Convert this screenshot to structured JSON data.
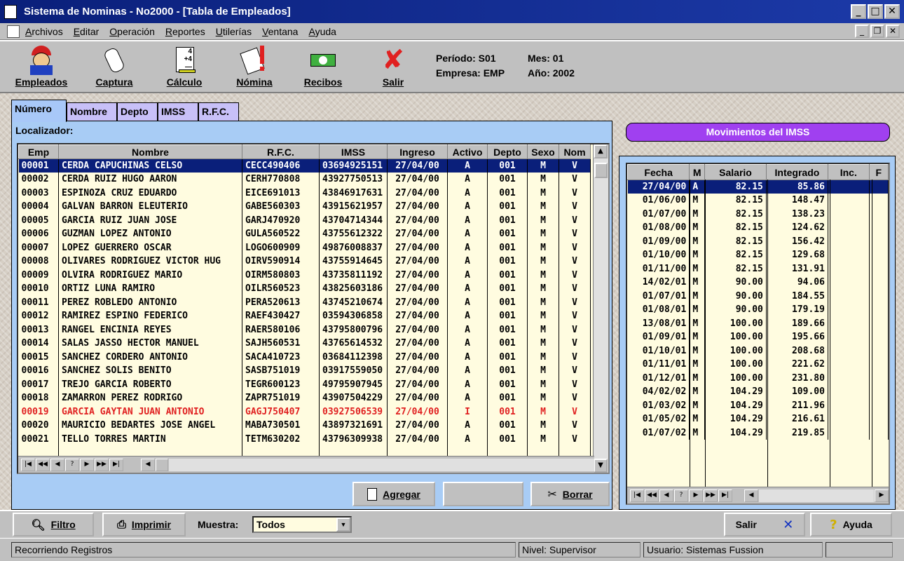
{
  "window": {
    "title": "Sistema de Nominas - No2000 - [Tabla de Empleados]"
  },
  "menu": [
    "Archivos",
    "Editar",
    "Operación",
    "Reportes",
    "Utilerías",
    "Ventana",
    "Ayuda"
  ],
  "toolbar": {
    "empleados": "Empleados",
    "captura": "Captura",
    "calculo": "Cálculo",
    "nomina": "Nómina",
    "recibos": "Recibos",
    "salir": "Salir"
  },
  "info": {
    "periodo": "Período: S01",
    "mes": "Mes: 01",
    "empresa": "Empresa: EMP",
    "anio": "Año: 2002"
  },
  "tabs": [
    "Número",
    "Nombre",
    "Depto",
    "IMSS",
    "R.F.C."
  ],
  "localizador": "Localizador:",
  "employees": {
    "columns": [
      "Emp",
      "Nombre",
      "R.F.C.",
      "IMSS",
      "Ingreso",
      "Activo",
      "Depto",
      "Sexo",
      "Nom"
    ],
    "rows": [
      [
        "00001",
        "CERDA CAPUCHINAS CELSO",
        "CECC490406",
        "03694925151",
        "27/04/00",
        "A",
        "001",
        "M",
        "V"
      ],
      [
        "00002",
        "CERDA RUIZ HUGO AARON",
        "CERH770808",
        "43927750513",
        "27/04/00",
        "A",
        "001",
        "M",
        "V"
      ],
      [
        "00003",
        "ESPINOZA CRUZ EDUARDO",
        "EICE691013",
        "43846917631",
        "27/04/00",
        "A",
        "001",
        "M",
        "V"
      ],
      [
        "00004",
        "GALVAN BARRON ELEUTERIO",
        "GABE560303",
        "43915621957",
        "27/04/00",
        "A",
        "001",
        "M",
        "V"
      ],
      [
        "00005",
        "GARCIA RUIZ JUAN JOSE",
        "GARJ470920",
        "43704714344",
        "27/04/00",
        "A",
        "001",
        "M",
        "V"
      ],
      [
        "00006",
        "GUZMAN LOPEZ ANTONIO",
        "GULA560522",
        "43755612322",
        "27/04/00",
        "A",
        "001",
        "M",
        "V"
      ],
      [
        "00007",
        "LOPEZ GUERRERO OSCAR",
        "LOGO600909",
        "49876008837",
        "27/04/00",
        "A",
        "001",
        "M",
        "V"
      ],
      [
        "00008",
        "OLIVARES RODRIGUEZ VICTOR HUG",
        "OIRV590914",
        "43755914645",
        "27/04/00",
        "A",
        "001",
        "M",
        "V"
      ],
      [
        "00009",
        "OLVIRA RODRIGUEZ MARIO",
        "OIRM580803",
        "43735811192",
        "27/04/00",
        "A",
        "001",
        "M",
        "V"
      ],
      [
        "00010",
        "ORTIZ LUNA RAMIRO",
        "OILR560523",
        "43825603186",
        "27/04/00",
        "A",
        "001",
        "M",
        "V"
      ],
      [
        "00011",
        "PEREZ ROBLEDO ANTONIO",
        "PERA520613",
        "43745210674",
        "27/04/00",
        "A",
        "001",
        "M",
        "V"
      ],
      [
        "00012",
        "RAMIREZ ESPINO FEDERICO",
        "RAEF430427",
        "03594306858",
        "27/04/00",
        "A",
        "001",
        "M",
        "V"
      ],
      [
        "00013",
        "RANGEL ENCINIA REYES",
        "RAER580106",
        "43795800796",
        "27/04/00",
        "A",
        "001",
        "M",
        "V"
      ],
      [
        "00014",
        "SALAS JASSO HECTOR MANUEL",
        "SAJH560531",
        "43765614532",
        "27/04/00",
        "A",
        "001",
        "M",
        "V"
      ],
      [
        "00015",
        "SANCHEZ CORDERO ANTONIO",
        "SACA410723",
        "03684112398",
        "27/04/00",
        "A",
        "001",
        "M",
        "V"
      ],
      [
        "00016",
        "SANCHEZ SOLIS BENITO",
        "SASB751019",
        "03917559050",
        "27/04/00",
        "A",
        "001",
        "M",
        "V"
      ],
      [
        "00017",
        "TREJO GARCIA ROBERTO",
        "TEGR600123",
        "49795907945",
        "27/04/00",
        "A",
        "001",
        "M",
        "V"
      ],
      [
        "00018",
        "ZAMARRON PEREZ RODRIGO",
        "ZAPR751019",
        "43907504229",
        "27/04/00",
        "A",
        "001",
        "M",
        "V"
      ],
      [
        "00019",
        "GARCIA GAYTAN JUAN ANTONIO",
        "GAGJ750407",
        "03927506539",
        "27/04/00",
        "I",
        "001",
        "M",
        "V"
      ],
      [
        "00020",
        "MAURICIO BEDARTES JOSE ANGEL",
        "MABA730501",
        "43897321691",
        "27/04/00",
        "A",
        "001",
        "M",
        "V"
      ],
      [
        "00021",
        "TELLO TORRES MARTIN",
        "TETM630202",
        "43796309938",
        "27/04/00",
        "A",
        "001",
        "M",
        "V"
      ]
    ]
  },
  "buttons": {
    "agregar": "Agregar",
    "borrar": "Borrar",
    "filtro": "Filtro",
    "imprimir": "Imprimir",
    "salir": "Salir",
    "ayuda": "Ayuda"
  },
  "navigator": [
    "|◀",
    "◀◀",
    "◀",
    "?",
    "▶",
    "▶▶",
    "▶|"
  ],
  "imss": {
    "title": "Movimientos del IMSS",
    "columns": [
      "Fecha",
      "M",
      "Salario",
      "Integrado",
      "Inc.",
      "F"
    ],
    "rows": [
      [
        "27/04/00",
        "A",
        "82.15",
        "85.86"
      ],
      [
        "01/06/00",
        "M",
        "82.15",
        "148.47"
      ],
      [
        "01/07/00",
        "M",
        "82.15",
        "138.23"
      ],
      [
        "01/08/00",
        "M",
        "82.15",
        "124.62"
      ],
      [
        "01/09/00",
        "M",
        "82.15",
        "156.42"
      ],
      [
        "01/10/00",
        "M",
        "82.15",
        "129.68"
      ],
      [
        "01/11/00",
        "M",
        "82.15",
        "131.91"
      ],
      [
        "14/02/01",
        "M",
        "90.00",
        "94.06"
      ],
      [
        "01/07/01",
        "M",
        "90.00",
        "184.55"
      ],
      [
        "01/08/01",
        "M",
        "90.00",
        "179.19"
      ],
      [
        "13/08/01",
        "M",
        "100.00",
        "189.66"
      ],
      [
        "01/09/01",
        "M",
        "100.00",
        "195.66"
      ],
      [
        "01/10/01",
        "M",
        "100.00",
        "208.68"
      ],
      [
        "01/11/01",
        "M",
        "100.00",
        "221.62"
      ],
      [
        "01/12/01",
        "M",
        "100.00",
        "231.80"
      ],
      [
        "04/02/02",
        "M",
        "104.29",
        "109.00"
      ],
      [
        "01/03/02",
        "M",
        "104.29",
        "211.96"
      ],
      [
        "01/05/02",
        "M",
        "104.29",
        "216.61"
      ],
      [
        "01/07/02",
        "M",
        "104.29",
        "219.85"
      ]
    ]
  },
  "muestra": {
    "label": "Muestra:",
    "value": "Todos"
  },
  "status": {
    "left": "Recorriendo Registros",
    "nivel": "Nivel: Supervisor",
    "usuario": "Usuario: Sistemas Fussion"
  }
}
